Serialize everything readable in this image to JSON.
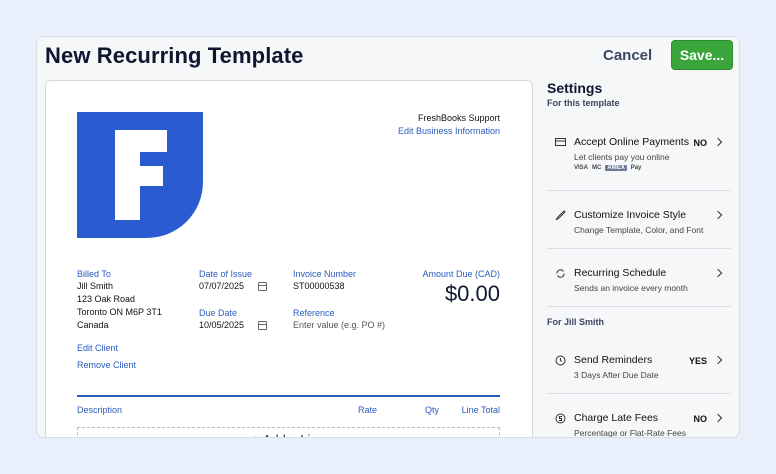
{
  "header": {
    "title": "New Recurring Template",
    "cancel_label": "Cancel",
    "save_label": "Save..."
  },
  "invoice": {
    "business_name": "FreshBooks Support",
    "edit_business_label": "Edit Business Information",
    "billed_to_label": "Billed To",
    "client": {
      "name": "Jill Smith",
      "address1": "123 Oak Road",
      "address2": "Toronto ON  M6P 3T1",
      "country": "Canada"
    },
    "edit_client_label": "Edit Client",
    "remove_client_label": "Remove Client",
    "date_of_issue_label": "Date of Issue",
    "date_of_issue": "07/07/2025",
    "due_date_label": "Due Date",
    "due_date": "10/05/2025",
    "invoice_number_label": "Invoice Number",
    "invoice_number": "ST00000538",
    "reference_label": "Reference",
    "reference_placeholder": "Enter value (e.g. PO #)",
    "amount_due_label": "Amount Due (CAD)",
    "amount_due": "$0.00",
    "columns": [
      "Description",
      "Rate",
      "Qty",
      "Line Total"
    ],
    "add_line_label": "+ Add a Line",
    "brand_color": "#2a5bd1"
  },
  "settings": {
    "title": "Settings",
    "template_section": "For this template",
    "client_section": "For Jill Smith",
    "items": [
      {
        "name": "Accept Online Payments",
        "desc": "Let clients pay you online",
        "status": "NO",
        "icon": "payment-icon"
      },
      {
        "name": "Customize Invoice Style",
        "desc": "Change Template, Color, and Font",
        "status": "",
        "icon": "brush-icon"
      },
      {
        "name": "Recurring Schedule",
        "desc": "Sends an invoice every month",
        "status": "",
        "icon": "refresh-icon"
      },
      {
        "name": "Send Reminders",
        "desc": "3 Days After Due Date",
        "status": "YES",
        "icon": "clock-icon"
      },
      {
        "name": "Charge Late Fees",
        "desc": "Percentage or Flat-Rate Fees",
        "status": "NO",
        "icon": "dollar-icon"
      }
    ],
    "payment_cards": [
      "VISA",
      "MC",
      "AMEX",
      "Pay"
    ]
  }
}
